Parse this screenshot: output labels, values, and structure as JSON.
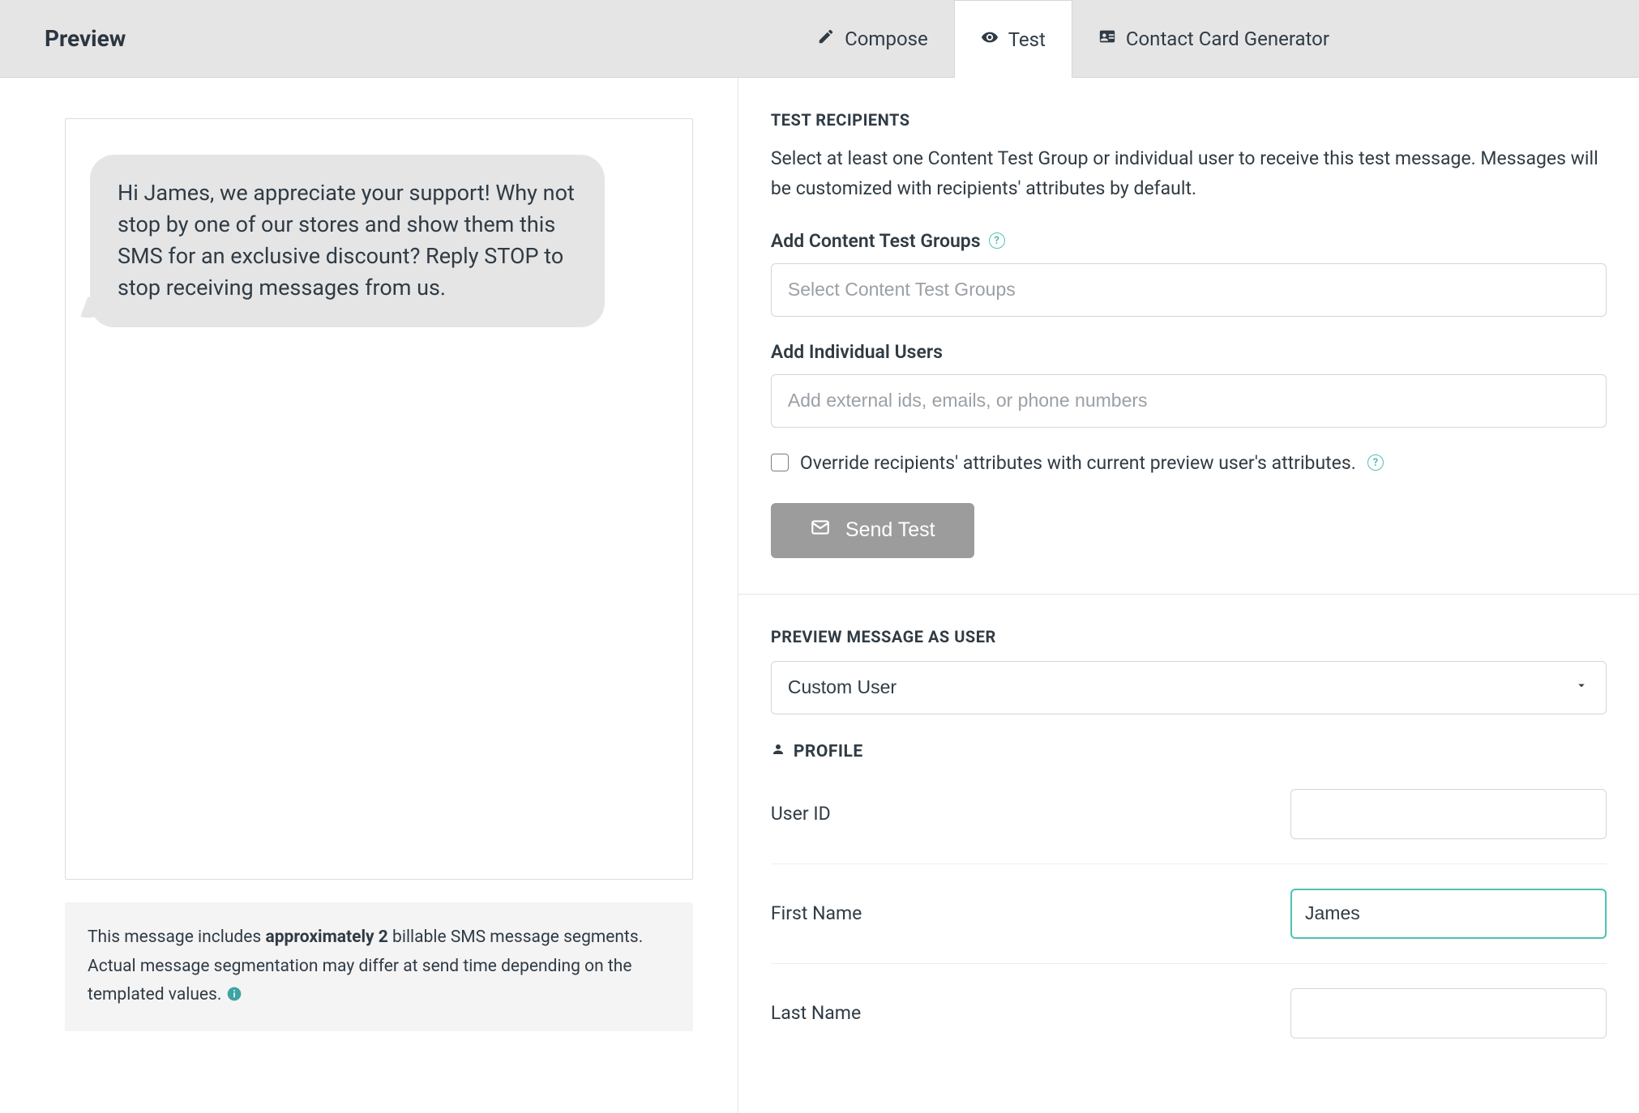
{
  "header": {
    "title": "Preview",
    "tabs": {
      "compose": "Compose",
      "test": "Test",
      "contact_card": "Contact Card Generator"
    }
  },
  "preview": {
    "bubble_text": "Hi James, we appreciate your support! Why not stop by one of our stores and show them this SMS for an exclusive discount? Reply STOP to stop receiving messages from us.",
    "segments_note_prefix": "This message includes ",
    "segments_note_bold": "approximately 2",
    "segments_note_suffix": " billable SMS message segments. Actual message segmentation may differ at send time depending on the templated values."
  },
  "test_panel": {
    "heading": "TEST RECIPIENTS",
    "desc": "Select at least one Content Test Group or individual user to receive this test message. Messages will be customized with recipients' attributes by default.",
    "groups_label": "Add Content Test Groups",
    "groups_placeholder": "Select Content Test Groups",
    "users_label": "Add Individual Users",
    "users_placeholder": "Add external ids, emails, or phone numbers",
    "override_label": "Override recipients' attributes with current preview user's attributes.",
    "send_label": "Send Test"
  },
  "preview_as": {
    "heading": "PREVIEW MESSAGE AS USER",
    "selected": "Custom User",
    "profile_heading": "PROFILE",
    "fields": {
      "user_id": {
        "label": "User ID",
        "value": ""
      },
      "first_name": {
        "label": "First Name",
        "value": "James"
      },
      "last_name": {
        "label": "Last Name",
        "value": ""
      }
    }
  }
}
